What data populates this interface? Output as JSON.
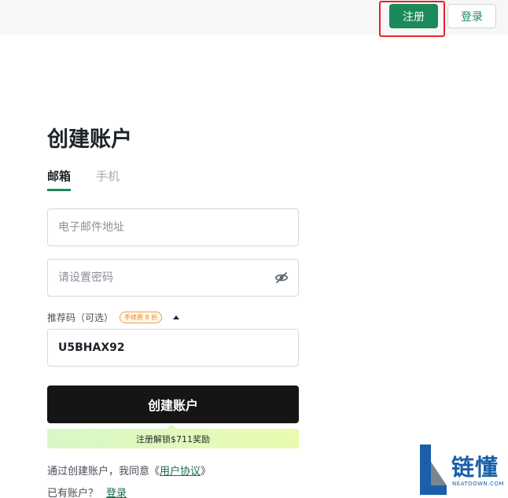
{
  "header": {
    "register_label": "注册",
    "login_label": "登录"
  },
  "form": {
    "title": "创建账户",
    "tabs": [
      {
        "label": "邮箱",
        "active": true
      },
      {
        "label": "手机",
        "active": false
      }
    ],
    "email_placeholder": "电子邮件地址",
    "password_placeholder": "请设置密码",
    "password_toggle_icon": "eye-off-icon",
    "referral_label": "推荐码（可选）",
    "fee_badge": "手续费 8 折",
    "referral_value": "U5BHAX92",
    "submit_label": "创建账户",
    "promo_text": "注册解锁$711奖励",
    "agree_prefix": "通过创建账户，我同意《",
    "agree_link": "用户协议",
    "agree_suffix": "》",
    "have_account": "已有账户？",
    "login_link": "登录"
  },
  "watermark": {
    "text": "链懂",
    "sub": "NEATDOWN.COM"
  },
  "colors": {
    "accent": "#1a8a5a",
    "highlight": "#e8212b",
    "button_dark": "#151515"
  }
}
